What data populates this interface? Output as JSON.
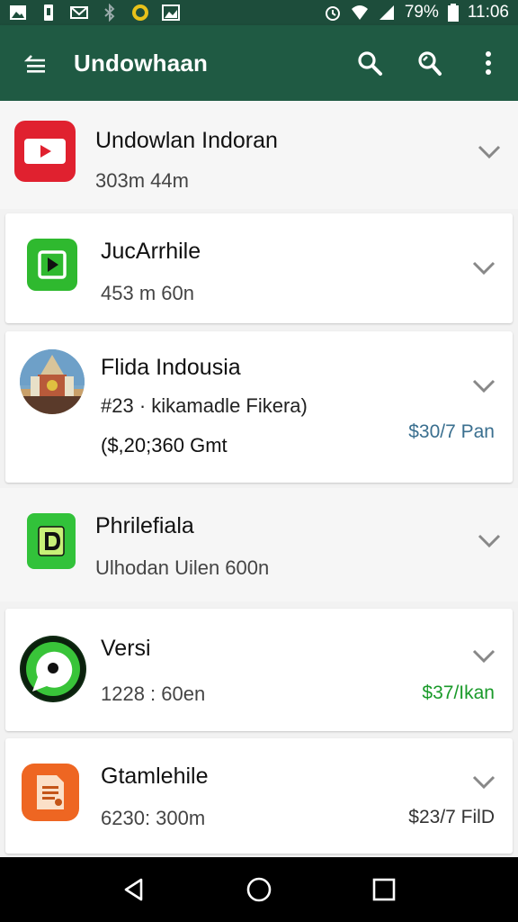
{
  "status_bar": {
    "battery": "79%",
    "time": "11:06",
    "icons": [
      "gallery-icon",
      "phone-icon",
      "mail-icon",
      "bluetooth-icon",
      "coin-icon",
      "image-icon",
      "alarm-icon",
      "wifi-icon",
      "signal-icon",
      "battery-icon"
    ]
  },
  "appbar": {
    "title": "Undowhaan",
    "icons": [
      "menu-icon",
      "search-icon",
      "search-alt-icon",
      "more-vert-icon"
    ]
  },
  "apps": [
    {
      "name": "Undowlan Indoran",
      "sub": "303m 44m",
      "price": ""
    },
    {
      "name": "JucArrhile",
      "sub": "453 m 60n",
      "price": ""
    },
    {
      "name": "Flida Indousia",
      "sub": "#23 · kikamadle Fikera)",
      "sub2": "($,20;360 Gmt",
      "price": "$30/7 Pan"
    },
    {
      "name": "Phrilefiala",
      "sub": "Ulhodan Uilen 600n",
      "price": ""
    },
    {
      "name": "Versi",
      "sub": "1228 : 60en",
      "price": "$37/Ikan"
    },
    {
      "name": "Gtamlehile",
      "sub": "6230: 300m",
      "price": "$23/7 FilD"
    }
  ],
  "colors": {
    "appbar": "#1f5a43",
    "statusbar": "#1d4d3b",
    "price_blue": "#3a6f8f",
    "price_green": "#1a9a2a",
    "price_dark": "#333333"
  },
  "navbar": {
    "icons": [
      "back-icon",
      "home-icon",
      "recents-icon"
    ]
  }
}
